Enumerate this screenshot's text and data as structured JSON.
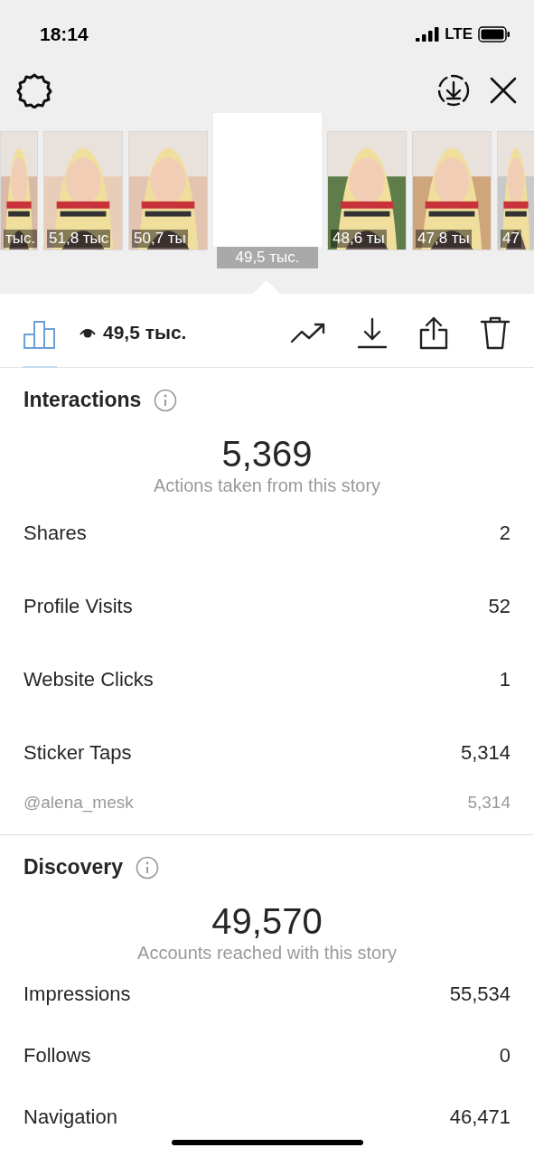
{
  "status_bar": {
    "time": "18:14",
    "network": "LTE"
  },
  "stories": [
    {
      "views": "тыс.",
      "selected": false
    },
    {
      "views": "51,8 тыс",
      "selected": false
    },
    {
      "views": "50,7 ты",
      "selected": false
    },
    {
      "views": "49,5 тыс.",
      "selected": true
    },
    {
      "views": "48,6 ты",
      "selected": false
    },
    {
      "views": "47,8 ты",
      "selected": false
    },
    {
      "views": "47",
      "selected": false
    }
  ],
  "toolbar": {
    "views": "49,5 тыс."
  },
  "sections": [
    {
      "title": "Interactions",
      "total": "5,369",
      "caption": "Actions taken from this story",
      "rows": [
        {
          "label": "Shares",
          "value": "2",
          "kind": "main"
        },
        {
          "label": "Profile Visits",
          "value": "52",
          "kind": "main"
        },
        {
          "label": "Website Clicks",
          "value": "1",
          "kind": "main"
        },
        {
          "label": "Sticker Taps",
          "value": "5,314",
          "kind": "main"
        },
        {
          "label": "@alena_mesk",
          "value": "5,314",
          "kind": "sub"
        }
      ]
    },
    {
      "title": "Discovery",
      "total": "49,570",
      "caption": "Accounts reached with this story",
      "rows": [
        {
          "label": "Impressions",
          "value": "55,534",
          "kind": "main"
        },
        {
          "label": "Follows",
          "value": "0",
          "kind": "main"
        },
        {
          "label": "Navigation",
          "value": "46,471",
          "kind": "main"
        }
      ]
    }
  ]
}
